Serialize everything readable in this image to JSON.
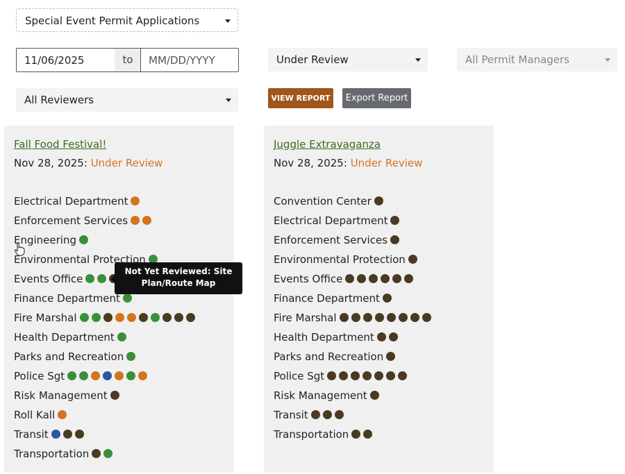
{
  "filters": {
    "application_type": "Special Event Permit Applications",
    "date_from": "11/06/2025",
    "date_to_placeholder": "MM/DD/YYYY",
    "to_label": "to",
    "status": "Under Review",
    "permit_managers": "All Permit Managers",
    "reviewers": "All Reviewers"
  },
  "buttons": {
    "view_report": "VIEW REPORT",
    "export_report": "Export Report"
  },
  "colors": {
    "approved": "#3b8f3a",
    "pending": "#d5731f",
    "not_reviewed": "#4a3a22",
    "other": "#2a57a5"
  },
  "cards": [
    {
      "title": "Fall Food Festival!",
      "date": "Nov 28, 2025:",
      "status": "Under Review",
      "departments": [
        {
          "name": "Electrical Department",
          "dots": [
            "o"
          ]
        },
        {
          "name": "Enforcement Services",
          "dots": [
            "o",
            "o"
          ]
        },
        {
          "name": "Engineering",
          "dots": [
            "g"
          ]
        },
        {
          "name": "Environmental Protection",
          "dots": [
            "g"
          ]
        },
        {
          "name": "Events Office",
          "dots": [
            "g",
            "g",
            "d",
            "d",
            "d",
            "d"
          ]
        },
        {
          "name": "Finance Department",
          "dots": [
            "g"
          ]
        },
        {
          "name": "Fire Marshal",
          "dots": [
            "g",
            "g",
            "d",
            "o",
            "o",
            "d",
            "g",
            "d",
            "d",
            "d"
          ]
        },
        {
          "name": "Health Department",
          "dots": [
            "g"
          ]
        },
        {
          "name": "Parks and Recreation",
          "dots": [
            "g"
          ]
        },
        {
          "name": "Police Sgt",
          "dots": [
            "g",
            "g",
            "o",
            "b",
            "o",
            "g",
            "o"
          ]
        },
        {
          "name": "Risk Management",
          "dots": [
            "d"
          ]
        },
        {
          "name": "Roll Kall",
          "dots": [
            "o"
          ]
        },
        {
          "name": "Transit",
          "dots": [
            "b",
            "d",
            "d"
          ]
        },
        {
          "name": "Transportation",
          "dots": [
            "d",
            "g"
          ]
        }
      ]
    },
    {
      "title": "Juggle Extravaganza",
      "date": "Nov 28, 2025:",
      "status": "Under Review",
      "departments": [
        {
          "name": "Convention Center",
          "dots": [
            "d"
          ]
        },
        {
          "name": "Electrical Department",
          "dots": [
            "d"
          ]
        },
        {
          "name": "Enforcement Services",
          "dots": [
            "d"
          ]
        },
        {
          "name": "Environmental Protection",
          "dots": [
            "d"
          ]
        },
        {
          "name": "Events Office",
          "dots": [
            "d",
            "d",
            "d",
            "d",
            "d",
            "d"
          ]
        },
        {
          "name": "Finance Department",
          "dots": [
            "d"
          ]
        },
        {
          "name": "Fire Marshal",
          "dots": [
            "d",
            "d",
            "d",
            "d",
            "d",
            "d",
            "d",
            "d"
          ]
        },
        {
          "name": "Health Department",
          "dots": [
            "d",
            "d"
          ]
        },
        {
          "name": "Parks and Recreation",
          "dots": [
            "d"
          ]
        },
        {
          "name": "Police Sgt",
          "dots": [
            "d",
            "d",
            "d",
            "d",
            "d",
            "d",
            "d"
          ]
        },
        {
          "name": "Risk Management",
          "dots": [
            "d"
          ]
        },
        {
          "name": "Transit",
          "dots": [
            "d",
            "d",
            "d"
          ]
        },
        {
          "name": "Transportation",
          "dots": [
            "d",
            "d"
          ]
        }
      ]
    }
  ],
  "tooltip": {
    "line1": "Not Yet Reviewed: Site",
    "line2": "Plan/Route Map"
  }
}
